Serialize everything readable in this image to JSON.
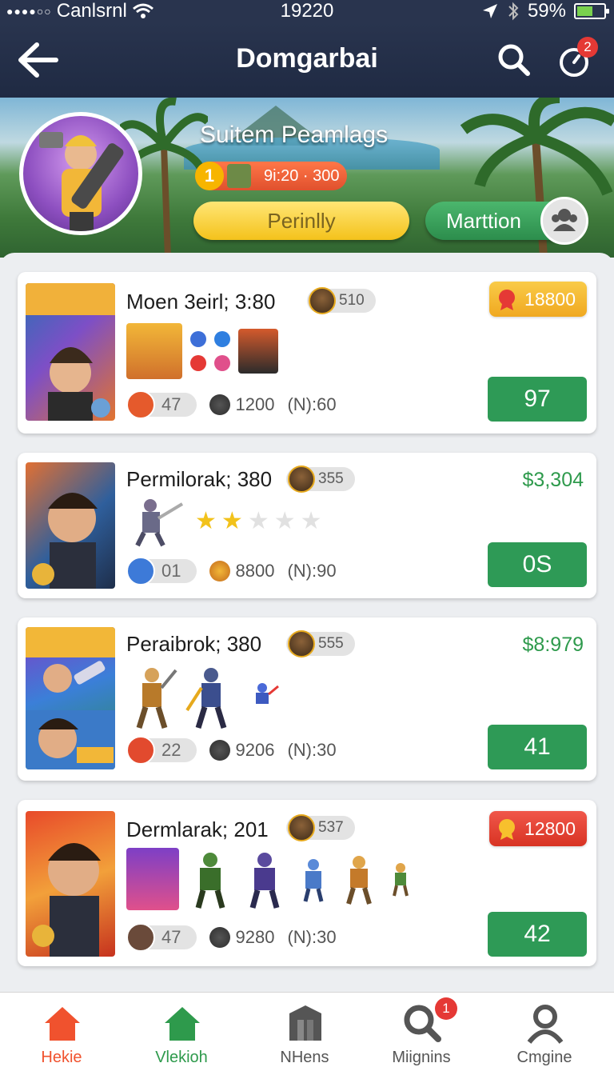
{
  "status_bar": {
    "carrier": "Canlsrnl",
    "time": "19220",
    "battery": "59%",
    "battery_level": 0.59
  },
  "header": {
    "title": "Domgarbai",
    "notification_count": "2"
  },
  "banner": {
    "title": "Suitem Peamlags",
    "rank_number": "1",
    "rank_text": "9i:20 · 300",
    "primary_button": "Perinlly",
    "secondary_button": "Marttion"
  },
  "cards": [
    {
      "title": "Moen 3eirl; 3:80",
      "pill_value": "510",
      "reward_value": "18800",
      "reward_color": "#f3b728",
      "chip_value": "47",
      "coins": "1200",
      "timer": "(N):60",
      "score": "97"
    },
    {
      "title": "Permilorak; 380",
      "pill_value": "355",
      "price": "$3,304",
      "rating": 2,
      "rating_max": 5,
      "chip_value": "01",
      "coins": "8800",
      "timer": "(N):90",
      "score": "0S"
    },
    {
      "title": "Peraibrok; 380",
      "pill_value": "555",
      "price": "$8:979",
      "chip_value": "22",
      "coins": "9206",
      "timer": "(N):30",
      "score": "41"
    },
    {
      "title": "Dermlarak; 201",
      "pill_value": "537",
      "reward_value": "12800",
      "reward_color": "#e8412e",
      "chip_value": "47",
      "coins": "9280",
      "timer": "(N):30",
      "score": "42"
    }
  ],
  "bottom_nav": [
    {
      "label": "Hekie",
      "color": "#f0522e"
    },
    {
      "label": "Vlekioh",
      "color": "#2e9a4c"
    },
    {
      "label": "NHens",
      "color": "#555555"
    },
    {
      "label": "Miignins",
      "color": "#555555",
      "badge": "1"
    },
    {
      "label": "Cmgine",
      "color": "#555555"
    }
  ]
}
